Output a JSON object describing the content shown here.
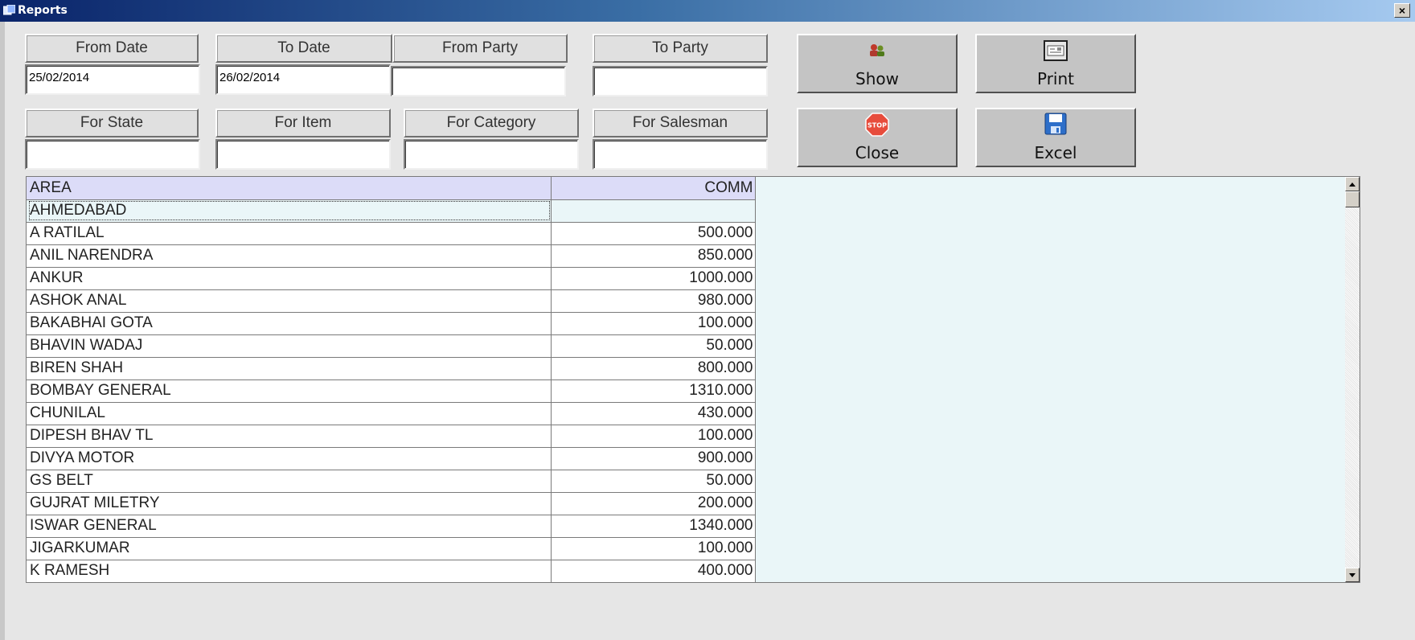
{
  "window": {
    "title": "Reports",
    "close_label": "×"
  },
  "filters": {
    "from_date": {
      "label": "From Date",
      "value": "25/02/2014"
    },
    "to_date": {
      "label": "To Date",
      "value": "26/02/2014"
    },
    "from_party": {
      "label": "From Party",
      "value": ""
    },
    "to_party": {
      "label": "To Party",
      "value": ""
    },
    "for_state": {
      "label": "For State",
      "value": ""
    },
    "for_item": {
      "label": "For Item",
      "value": ""
    },
    "for_category": {
      "label": "For Category",
      "value": ""
    },
    "for_salesman": {
      "label": "For Salesman",
      "value": ""
    }
  },
  "buttons": {
    "show": {
      "label": "Show",
      "icon": "users-icon"
    },
    "print": {
      "label": "Print",
      "icon": "printer-icon"
    },
    "close": {
      "label": "Close",
      "icon": "stop-sign-icon"
    },
    "excel": {
      "label": "Excel",
      "icon": "floppy-disk-icon"
    }
  },
  "grid": {
    "columns": [
      "AREA",
      "COMM"
    ],
    "area_row": {
      "area": "AHMEDABAD",
      "comm": ""
    },
    "rows": [
      {
        "name": "A RATILAL",
        "comm": "500.000"
      },
      {
        "name": "ANIL NARENDRA",
        "comm": "850.000"
      },
      {
        "name": "ANKUR",
        "comm": "1000.000"
      },
      {
        "name": "ASHOK ANAL",
        "comm": "980.000"
      },
      {
        "name": "BAKABHAI GOTA",
        "comm": "100.000"
      },
      {
        "name": "BHAVIN WADAJ",
        "comm": "50.000"
      },
      {
        "name": "BIREN SHAH",
        "comm": "800.000"
      },
      {
        "name": "BOMBAY GENERAL",
        "comm": "1310.000"
      },
      {
        "name": "CHUNILAL",
        "comm": "430.000"
      },
      {
        "name": "DIPESH BHAV TL",
        "comm": "100.000"
      },
      {
        "name": "DIVYA MOTOR",
        "comm": "900.000"
      },
      {
        "name": "GS BELT",
        "comm": "50.000"
      },
      {
        "name": "GUJRAT MILETRY",
        "comm": "200.000"
      },
      {
        "name": "ISWAR GENERAL",
        "comm": "1340.000"
      },
      {
        "name": "JIGARKUMAR",
        "comm": "100.000"
      },
      {
        "name": "K RAMESH",
        "comm": "400.000"
      }
    ]
  }
}
